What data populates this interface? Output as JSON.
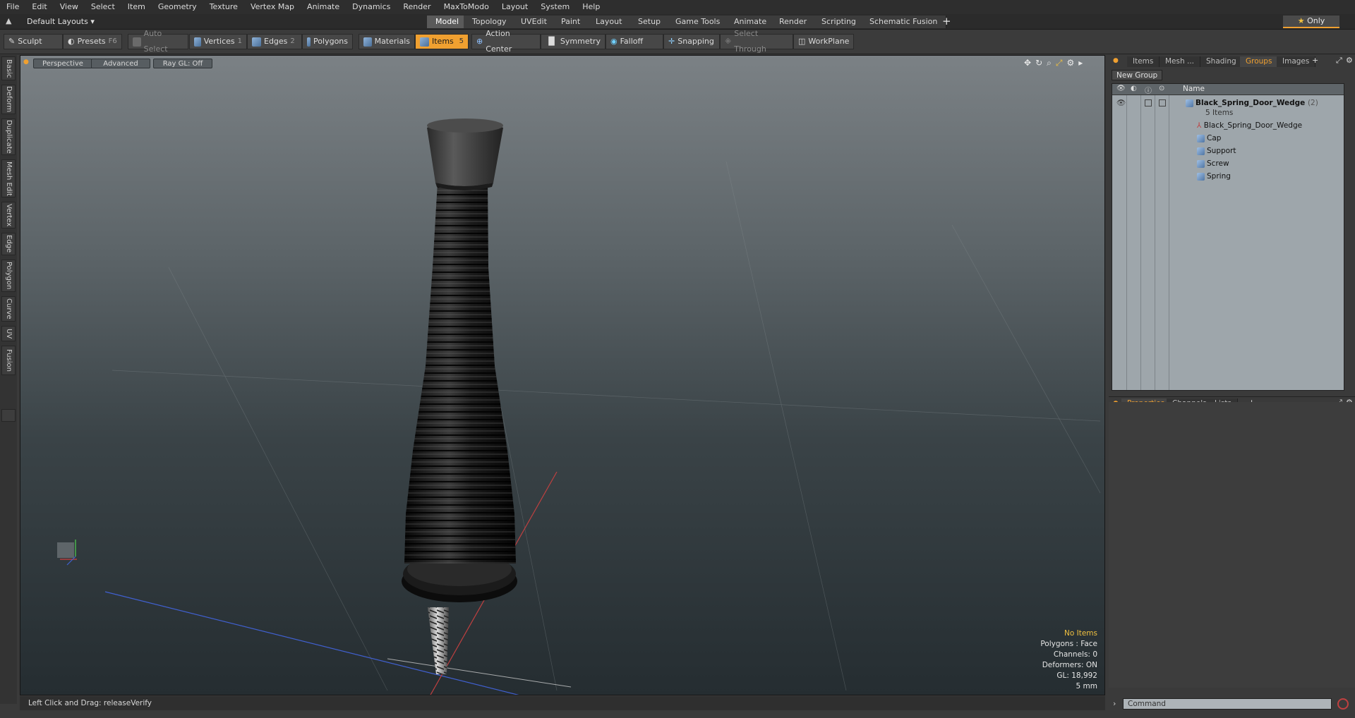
{
  "menubar": {
    "items": [
      "File",
      "Edit",
      "View",
      "Select",
      "Item",
      "Geometry",
      "Texture",
      "Vertex Map",
      "Animate",
      "Dynamics",
      "Render",
      "MaxToModo",
      "Layout",
      "System",
      "Help"
    ]
  },
  "layoutbar": {
    "layout_selector": "Default Layouts",
    "tabs": [
      "Model",
      "Topology",
      "UVEdit",
      "Paint",
      "Layout",
      "Setup",
      "Game Tools",
      "Animate",
      "Render",
      "Scripting",
      "Schematic Fusion"
    ],
    "active_tab": "Model",
    "add_symbol": "+",
    "only_label": "Only"
  },
  "toolbar": {
    "sculpt": "Sculpt",
    "presets": "Presets",
    "presets_key": "F6",
    "auto_select": "Auto Select",
    "vertices": "Vertices",
    "vertices_key": "1",
    "edges": "Edges",
    "edges_key": "2",
    "polygons": "Polygons",
    "materials": "Materials",
    "items": "Items",
    "items_key": "5",
    "action_center": "Action Center",
    "symmetry": "Symmetry",
    "falloff": "Falloff",
    "snapping": "Snapping",
    "select_through": "Select Through",
    "workplane": "WorkPlane"
  },
  "left_tabs": [
    "Basic",
    "Deform",
    "Duplicate",
    "Mesh Edit",
    "Vertex",
    "Edge",
    "Polygon",
    "Curve",
    "UV",
    "Fusion"
  ],
  "viewport": {
    "view": "Perspective",
    "shading": "Advanced",
    "raygl": "Ray GL: Off",
    "stats": [
      "No Items",
      "Polygons : Face",
      "Channels: 0",
      "Deformers: ON",
      "GL: 18,992",
      "5 mm"
    ]
  },
  "statusbar": {
    "text": "Left Click and Drag:   releaseVerify"
  },
  "right_panel": {
    "top_tabs": [
      "Items",
      "Mesh ...",
      "Shading",
      "Groups",
      "Images"
    ],
    "active_top_tab": "Groups",
    "new_group": "New Group",
    "name_header": "Name",
    "group_name": "Black_Spring_Door_Wedge",
    "group_count": "(2)",
    "group_items_count": "5 Items",
    "children": [
      "Black_Spring_Door_Wedge",
      "Cap",
      "Support",
      "Screw",
      "Spring"
    ],
    "bottom_tabs": [
      "Properties",
      "Channels",
      "Lists"
    ],
    "active_bottom_tab": "Properties",
    "command_placeholder": "Command"
  },
  "colors": {
    "accent": "#f0a030",
    "viewport_top": "#7b8185",
    "viewport_bottom": "#252d31"
  }
}
